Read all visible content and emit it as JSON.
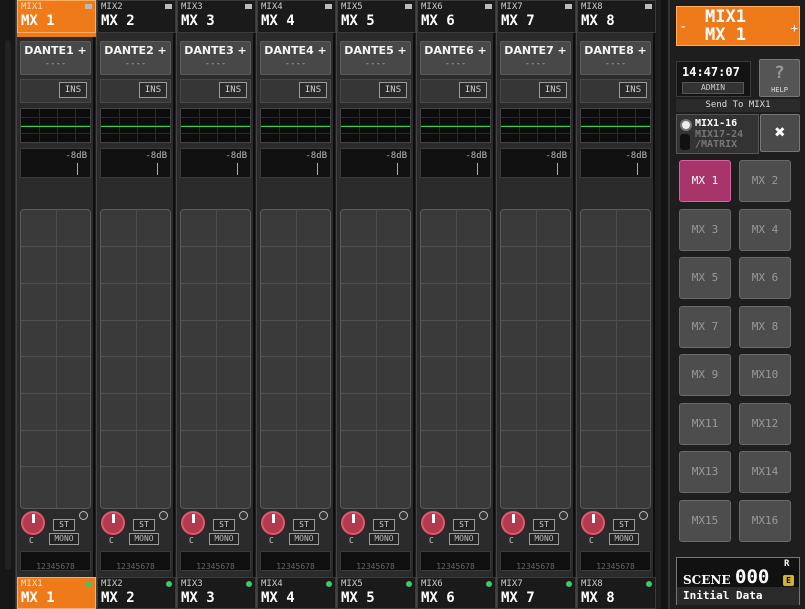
{
  "channels": [
    {
      "tab_small": "MIX1",
      "tab_big": "MX 1",
      "patch": "DANTE1 +",
      "patch_sub": "----",
      "ins": "INS",
      "db": "-8dB",
      "pan": "C",
      "st": "ST",
      "mono": "MONO",
      "nums": "12345678"
    },
    {
      "tab_small": "MIX2",
      "tab_big": "MX 2",
      "patch": "DANTE2 +",
      "patch_sub": "----",
      "ins": "INS",
      "db": "-8dB",
      "pan": "C",
      "st": "ST",
      "mono": "MONO",
      "nums": "12345678"
    },
    {
      "tab_small": "MIX3",
      "tab_big": "MX 3",
      "patch": "DANTE3 +",
      "patch_sub": "----",
      "ins": "INS",
      "db": "-8dB",
      "pan": "C",
      "st": "ST",
      "mono": "MONO",
      "nums": "12345678"
    },
    {
      "tab_small": "MIX4",
      "tab_big": "MX 4",
      "patch": "DANTE4 +",
      "patch_sub": "----",
      "ins": "INS",
      "db": "-8dB",
      "pan": "C",
      "st": "ST",
      "mono": "MONO",
      "nums": "12345678"
    },
    {
      "tab_small": "MIX5",
      "tab_big": "MX 5",
      "patch": "DANTE5 +",
      "patch_sub": "----",
      "ins": "INS",
      "db": "-8dB",
      "pan": "C",
      "st": "ST",
      "mono": "MONO",
      "nums": "12345678"
    },
    {
      "tab_small": "MIX6",
      "tab_big": "MX 6",
      "patch": "DANTE6 +",
      "patch_sub": "----",
      "ins": "INS",
      "db": "-8dB",
      "pan": "C",
      "st": "ST",
      "mono": "MONO",
      "nums": "12345678"
    },
    {
      "tab_small": "MIX7",
      "tab_big": "MX 7",
      "patch": "DANTE7 +",
      "patch_sub": "----",
      "ins": "INS",
      "db": "-8dB",
      "pan": "C",
      "st": "ST",
      "mono": "MONO",
      "nums": "12345678"
    },
    {
      "tab_small": "MIX8",
      "tab_big": "MX 8",
      "patch": "DANTE8 +",
      "patch_sub": "----",
      "ins": "INS",
      "db": "-8dB",
      "pan": "C",
      "st": "ST",
      "mono": "MONO",
      "nums": "12345678"
    }
  ],
  "selected": {
    "line1": "MIX1",
    "line2": "MX 1",
    "minus": "-",
    "plus": "+"
  },
  "clock": {
    "time": "14:47:07",
    "user": "ADMIN"
  },
  "help": {
    "label": "HELP",
    "glyph": "?"
  },
  "send_to": "Send To MIX1",
  "bank": {
    "line1": "MIX1-16",
    "line2": "MIX17-24",
    "line3": "/MATRIX"
  },
  "close_glyph": "✖",
  "mix_buttons": [
    "MX 1",
    "MX 2",
    "MX 3",
    "MX 4",
    "MX 5",
    "MX 6",
    "MX 7",
    "MX 8",
    "MX 9",
    "MX10",
    "MX11",
    "MX12",
    "MX13",
    "MX14",
    "MX15",
    "MX16"
  ],
  "active_mix": "MX 1",
  "scene": {
    "label": "SCENE",
    "number": "000",
    "r": "R",
    "e": "E",
    "name": "Initial Data"
  },
  "colors": {
    "accent": "#ef7a1a",
    "active_button": "#a8356a",
    "eq_line": "#3bd04a"
  }
}
